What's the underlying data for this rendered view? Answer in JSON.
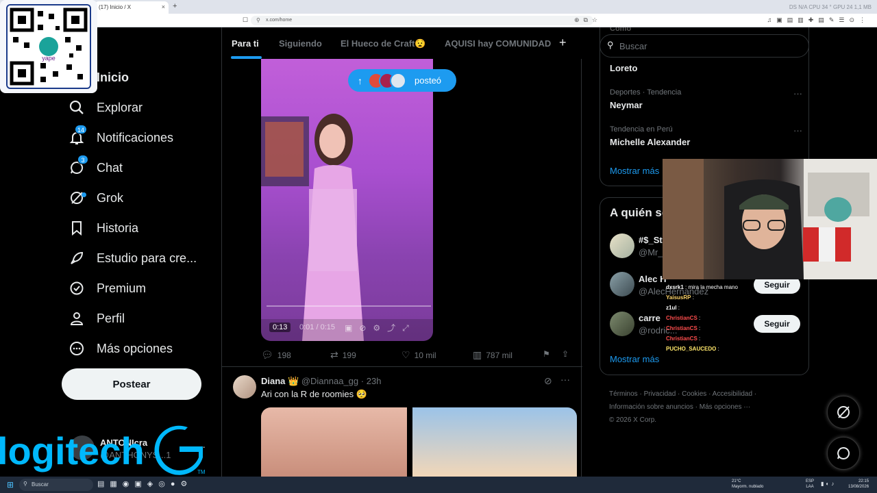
{
  "browser": {
    "tab_title": "(17) Inicio / X",
    "tab_close": "×",
    "new_tab": "+",
    "url": "x.com/home",
    "tabbar_right": "DS N/A   CPU 34 °   GPU 24   1,1 MB"
  },
  "nav": {
    "items": [
      {
        "label": "Inicio",
        "icon": "home-icon"
      },
      {
        "label": "Explorar",
        "icon": "search-icon"
      },
      {
        "label": "Notificaciones",
        "icon": "bell-icon",
        "badge": "14"
      },
      {
        "label": "Chat",
        "icon": "chat-icon",
        "badge": "3"
      },
      {
        "label": "Grok",
        "icon": "grok-icon"
      },
      {
        "label": "Historia",
        "icon": "bookmark-icon"
      },
      {
        "label": "Estudio para cre...",
        "icon": "rocket-icon"
      },
      {
        "label": "Premium",
        "icon": "verified-icon"
      },
      {
        "label": "Perfil",
        "icon": "person-icon"
      },
      {
        "label": "Más opciones",
        "icon": "more-circle-icon"
      }
    ],
    "post_button": "Postear"
  },
  "account": {
    "name": "ANTONIcra",
    "handle": "@ANTHONYS...1",
    "more": "···"
  },
  "qr": {
    "brand": "yape"
  },
  "logo": {
    "text": "logitech",
    "tm": "TM"
  },
  "feed": {
    "tabs": [
      "Para ti",
      "Siguiendo",
      "El Hueco de Craft😧",
      "AQUISI hay COMUNIDAD"
    ],
    "add_tab": "+",
    "posted_pill": "posteó",
    "video": {
      "duration": "0:13",
      "progress": "0:01 / 0:15"
    },
    "actions": {
      "replies": "198",
      "reposts": "199",
      "likes": "10 mil",
      "views": "787 mil"
    },
    "tweet2": {
      "name": "Diana 👑",
      "handle": "@Diannaa_gg",
      "time": "23h",
      "text": "Ari con la R de roomies 🥺"
    }
  },
  "search": {
    "placeholder": "Buscar"
  },
  "trends": {
    "items": [
      {
        "category": "",
        "name": "Loreto"
      },
      {
        "category": "Deportes · Tendencia",
        "name": "Neymar"
      },
      {
        "category": "Tendencia en Perú",
        "name": "Michelle Alexander"
      }
    ],
    "show_more": "Mostrar más",
    "cut_top": "Cómo"
  },
  "who_to_follow": {
    "title": "A quién seguir",
    "accounts": [
      {
        "name": "#$_St",
        "handle": "@Mr_..."
      },
      {
        "name": "Alec H",
        "handle": "@AlecHernandez",
        "button": "Seguir"
      },
      {
        "name": "carre",
        "handle": "@rodric...",
        "button": "Seguir"
      }
    ],
    "show_more": "Mostrar más"
  },
  "footer": {
    "links": [
      "Términos",
      "Privacidad",
      "Cookies",
      "Accesibilidad",
      "Información sobre anuncios",
      "Más opciones ···"
    ],
    "copyright": "© 2026 X Corp."
  },
  "stream_chat": [
    {
      "user": "dxsrk1",
      "msg": "mira la mecha mano"
    },
    {
      "user": "YaisusRP",
      "msg": ""
    },
    {
      "user": "z1ul",
      "msg": ""
    },
    {
      "user": "ChristianCS",
      "msg": ""
    },
    {
      "user": "ChristianCS",
      "msg": ""
    },
    {
      "user": "ChristianCS",
      "msg": ""
    },
    {
      "user": "PUCHO_SAUCEDO",
      "msg": ""
    }
  ],
  "taskbar": {
    "search": "Buscar",
    "weather_temp": "21°C",
    "weather_desc": "Mayorm. nublado",
    "lang1": "ESP",
    "lang2": "LAA",
    "time": "22:15",
    "date": "13/08/2026"
  },
  "colors": {
    "accent": "#1d9bf0",
    "bg": "#000000",
    "text": "#e7e9ea",
    "muted": "#71767b"
  }
}
